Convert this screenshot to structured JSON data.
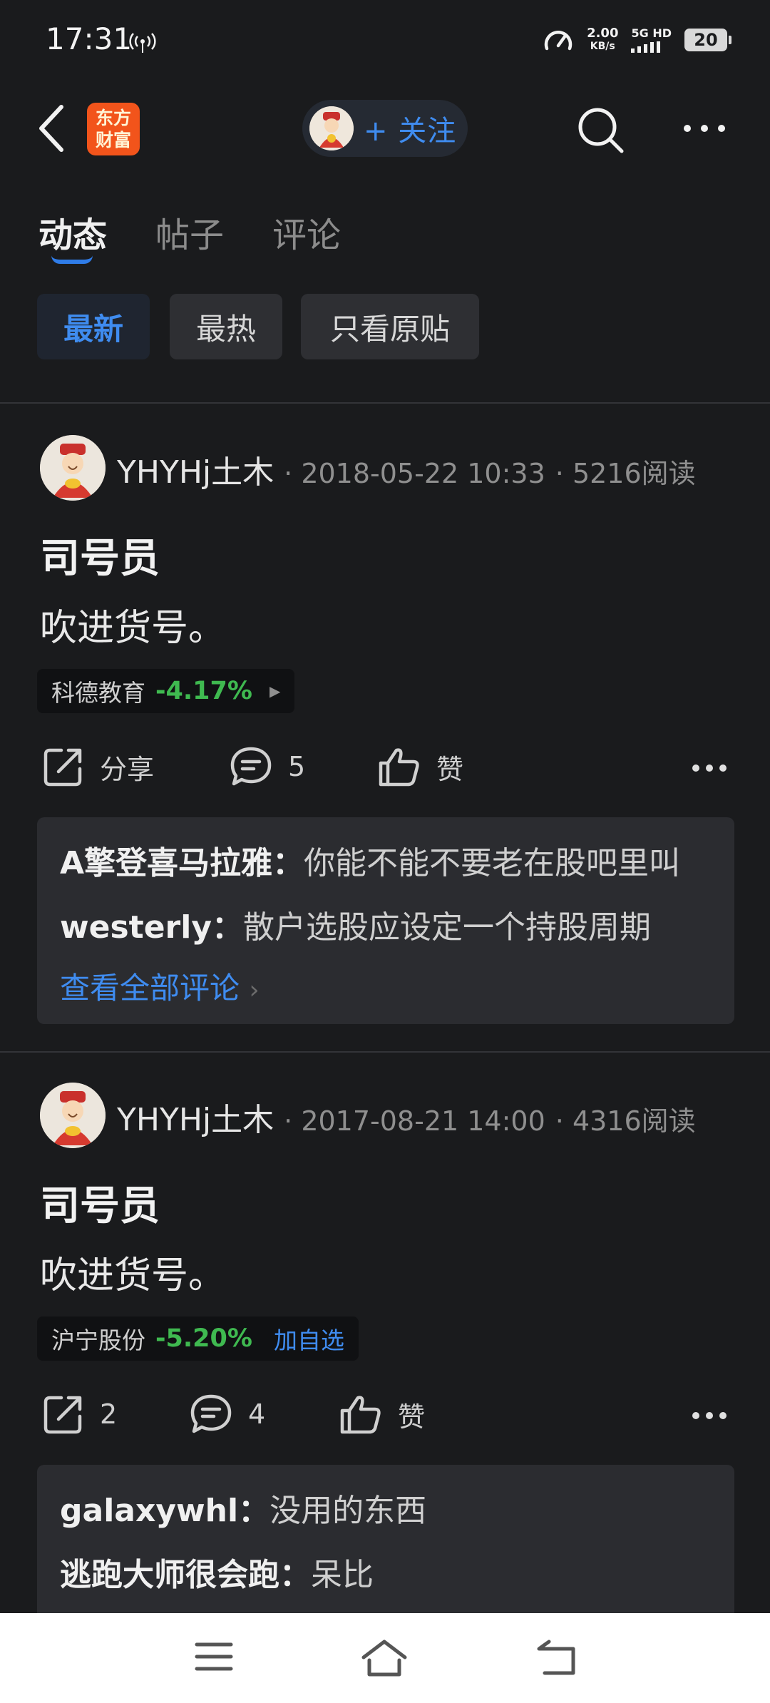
{
  "status_bar": {
    "time": "17:31",
    "net_speed_value": "2.00",
    "net_speed_unit": "KB/s",
    "signal_label": "5G HD",
    "battery": "20"
  },
  "header": {
    "logo_line1": "东方",
    "logo_line2": "财富",
    "follow_label": "+ 关注"
  },
  "tabs": [
    {
      "label": "动态",
      "active": true
    },
    {
      "label": "帖子",
      "active": false
    },
    {
      "label": "评论",
      "active": false
    }
  ],
  "filters": [
    {
      "label": "最新",
      "active": true
    },
    {
      "label": "最热",
      "active": false
    },
    {
      "label": "只看原贴",
      "active": false
    }
  ],
  "posts": [
    {
      "author": "YHYHj土木",
      "date": "2018-05-22 10:33",
      "reads": "5216阅读",
      "title": "司号员",
      "body": "吹进货号。",
      "stock_name": "科德教育",
      "stock_change": "-4.17%",
      "share_label": "分享",
      "comment_count": "5",
      "like_label": "赞",
      "comments": [
        {
          "author": "A擎登喜马拉雅",
          "text": "你能不能不要老在股吧里叫"
        },
        {
          "author": "westerly",
          "text": "散户选股应设定一个持股周期"
        }
      ],
      "view_all": "查看全部评论"
    },
    {
      "author": "YHYHj土木",
      "date": "2017-08-21 14:00",
      "reads": "4316阅读",
      "title": "司号员",
      "body": "吹进货号。",
      "stock_name": "沪宁股份",
      "stock_change": "-5.20%",
      "stock_add": "加自选",
      "share_label": "2",
      "comment_count": "4",
      "like_label": "赞",
      "comments": [
        {
          "author": "galaxywhl",
          "text": "没用的东西"
        },
        {
          "author": "逃跑大师很会跑",
          "text": "呆比"
        }
      ]
    }
  ],
  "icons": {
    "back": "back-arrow-icon",
    "search": "search-icon",
    "more": "more-icon",
    "share": "share-icon",
    "comment": "comment-icon",
    "like": "thumbs-up-icon",
    "menu": "menu-icon",
    "home": "home-icon",
    "return": "back-nav-icon"
  },
  "colors": {
    "background": "#1a1b1d",
    "accent": "#3f8cf0",
    "down": "#3fb950",
    "logo": "#f2541b"
  }
}
